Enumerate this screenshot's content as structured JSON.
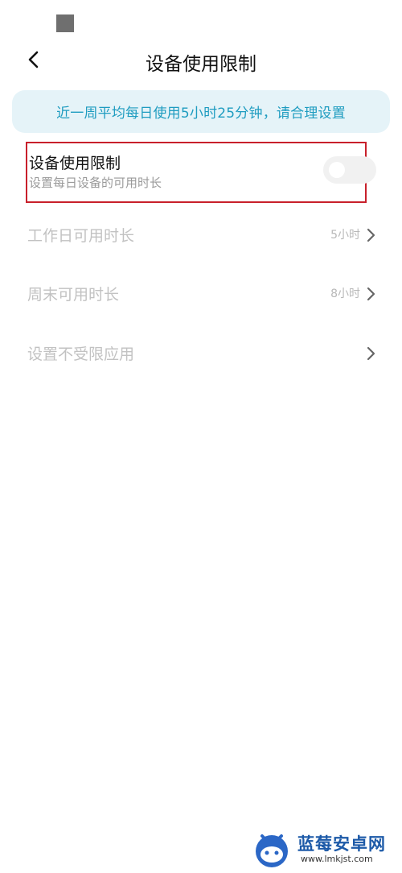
{
  "header": {
    "title": "设备使用限制",
    "back_icon": "chevron-left-icon"
  },
  "banner": {
    "text": "近一周平均每日使用5小时25分钟，请合理设置"
  },
  "device_limit": {
    "title": "设备使用限制",
    "subtitle": "设置每日设备的可用时长",
    "enabled": false
  },
  "rows": [
    {
      "label": "工作日可用时长",
      "value": "5小时"
    },
    {
      "label": "周末可用时长",
      "value": "8小时"
    },
    {
      "label": "设置不受限应用",
      "value": ""
    }
  ],
  "watermark": {
    "title": "蓝莓安卓网",
    "url": "www.lmkjst.com"
  },
  "colors": {
    "accent": "#1e9cc0",
    "banner_bg": "#e5f3f8",
    "highlight_border": "#c8202b",
    "disabled_text": "#c2c2c2"
  }
}
